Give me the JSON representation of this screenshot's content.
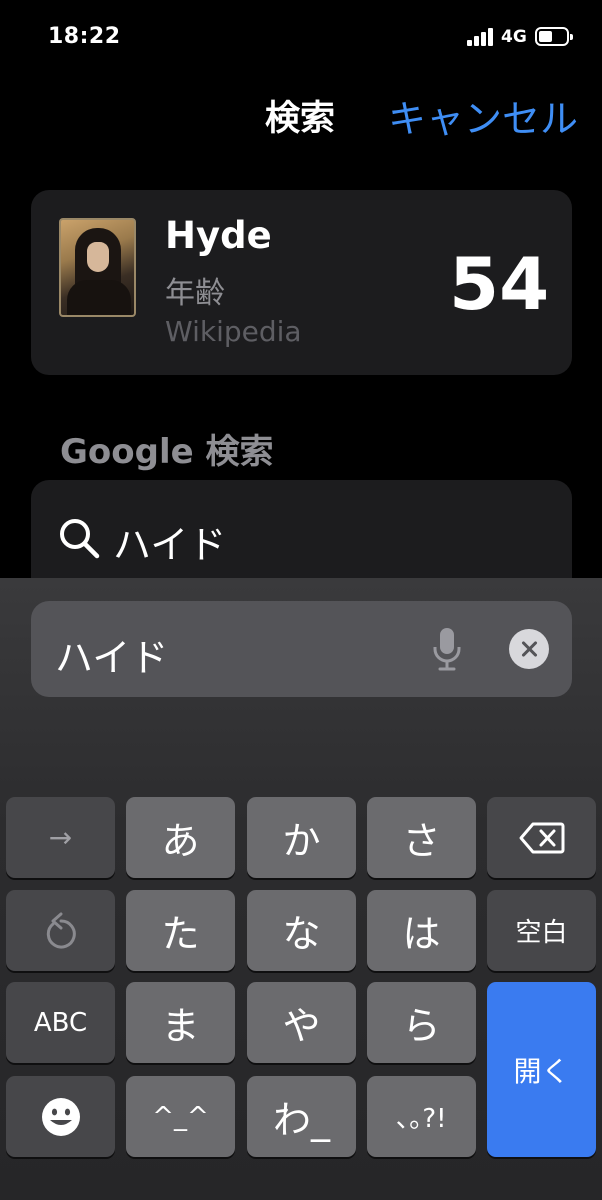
{
  "status_bar": {
    "time": "18:22",
    "network": "4G",
    "battery_level": 0.5,
    "signal_bars": 4
  },
  "header": {
    "title": "検索",
    "cancel_label": "キャンセル"
  },
  "result_card": {
    "name": "Hyde",
    "attribute": "年齢",
    "value": "54",
    "source": "Wikipedia"
  },
  "google_section": {
    "heading": "Google 検索",
    "query": "ハイド"
  },
  "search_field": {
    "value": "ハイド"
  },
  "keyboard": {
    "row1": [
      "→",
      "あ",
      "か",
      "さ",
      "⌫"
    ],
    "row2": [
      "↺",
      "た",
      "な",
      "は",
      "空白"
    ],
    "row3": [
      "ABC",
      "ま",
      "や",
      "ら"
    ],
    "row4": [
      "☻",
      "^_^",
      "わ_",
      "､｡?!"
    ],
    "open_label": "開く"
  },
  "colors": {
    "accent": "#3f8ef5",
    "open_key": "#3a7bf0",
    "card_bg": "#1c1c1e"
  }
}
